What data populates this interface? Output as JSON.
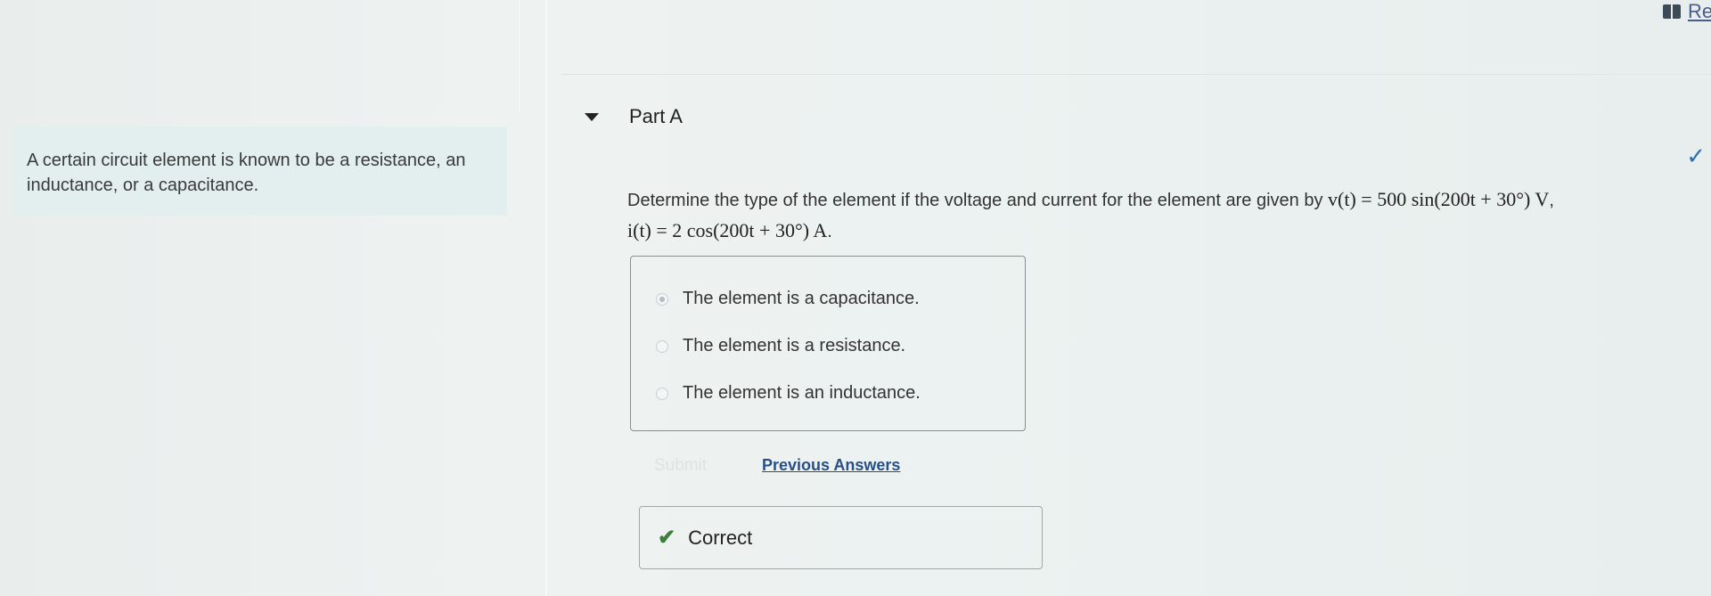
{
  "top_right": {
    "link_label": "Re"
  },
  "intro": {
    "text": "A certain circuit element is known to be a resistance, an inductance, or a capacitance."
  },
  "part": {
    "title": "Part A"
  },
  "question": {
    "text_before": "Determine the type of the element if the voltage and current for the element are given by",
    "voltage_expr": "v(t) = 500 sin(200t + 30°) V",
    "current_expr": "i(t) = 2 cos(200t + 30°) A"
  },
  "options": [
    {
      "label": "The element is a capacitance.",
      "selected": true
    },
    {
      "label": "The element is a resistance.",
      "selected": false
    },
    {
      "label": "The element is an inductance.",
      "selected": false
    }
  ],
  "actions": {
    "submit_label": "Submit",
    "previous_answers_label": "Previous Answers"
  },
  "feedback": {
    "label": "Correct"
  },
  "colors": {
    "correct_green": "#3d7f3a",
    "link_blue": "#2a4f86",
    "check_blue": "#2c6fb0"
  }
}
